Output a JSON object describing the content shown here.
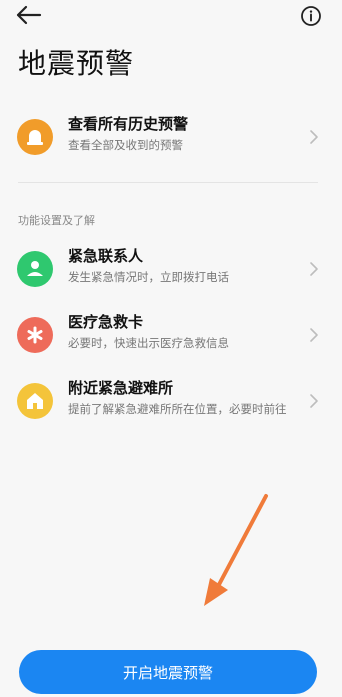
{
  "header": {
    "title": "地震预警"
  },
  "history": {
    "title": "查看所有历史预警",
    "subtitle": "查看全部及收到的预警",
    "color": "#f19c2a"
  },
  "section": {
    "label": "功能设置及了解"
  },
  "items": [
    {
      "title": "紧急联系人",
      "subtitle": "发生紧急情况时，立即拨打电话",
      "color": "#2fc86f"
    },
    {
      "title": "医疗急救卡",
      "subtitle": "必要时，快速出示医疗急救信息",
      "color": "#ee6b5a"
    },
    {
      "title": "附近紧急避难所",
      "subtitle": "提前了解紧急避难所所在位置，必要时前往",
      "color": "#f4c43a"
    }
  ],
  "cta": {
    "label": "开启地震预警",
    "color": "#1b86f2"
  },
  "annotation": {
    "color": "#f07b3a"
  }
}
